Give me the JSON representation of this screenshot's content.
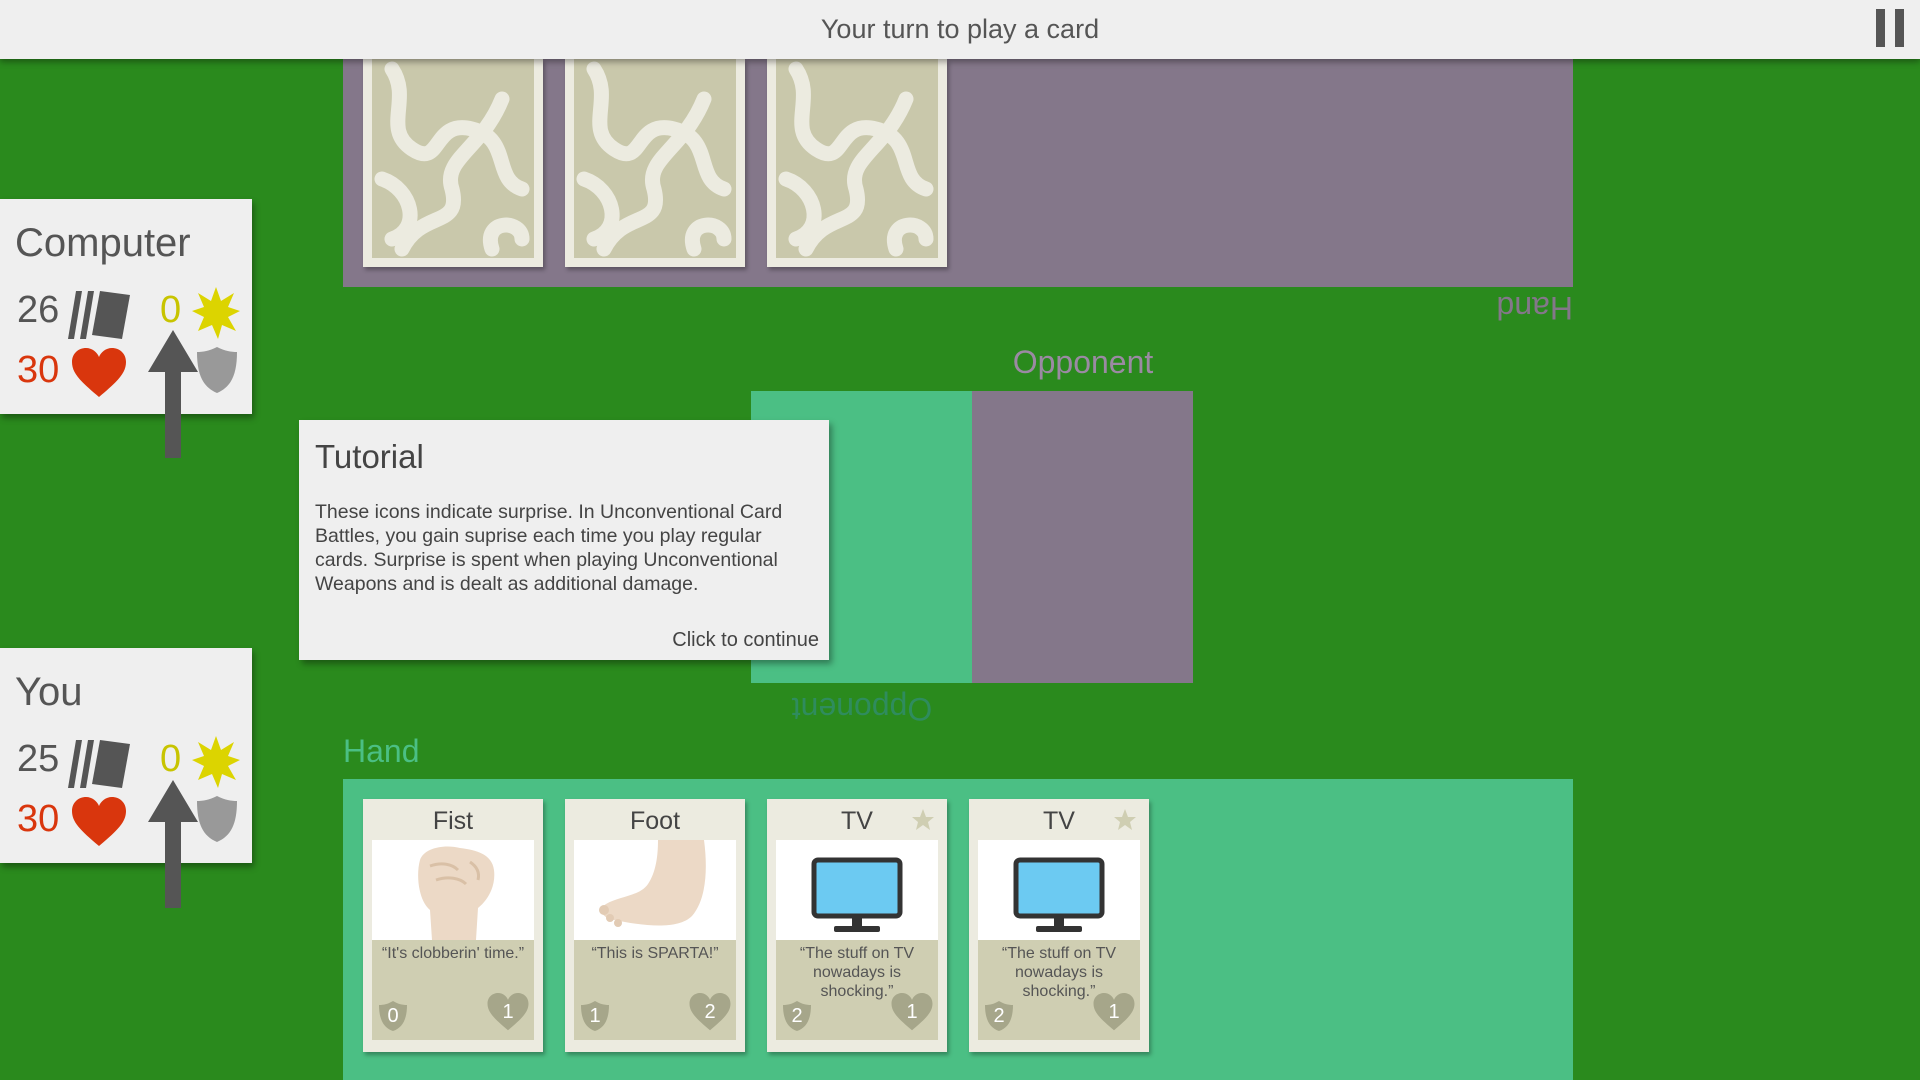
{
  "status": {
    "message": "Your turn to play a card",
    "pause_icon": "pause-icon"
  },
  "opponent_area": {
    "hand_label": "Hand",
    "hand_card_count": 3,
    "play_label": "Opponent"
  },
  "player_area": {
    "hand_label": "Hand",
    "play_label": "Opponent"
  },
  "computer": {
    "name": "Computer",
    "deck": "26",
    "health": "30",
    "surprise": "0"
  },
  "you": {
    "name": "You",
    "deck": "25",
    "health": "30",
    "surprise": "0"
  },
  "tutorial": {
    "title": "Tutorial",
    "body": "These icons indicate surprise. In Unconventional Card Battles, you gain suprise each time you play regular cards. Surprise is spent when playing Unconventional Weapons and is dealt as additional damage.",
    "continue": "Click to continue"
  },
  "hand": [
    {
      "title": "Fist",
      "quote": "“It's clobberin' time.”",
      "cost": "0",
      "damage": "1",
      "art": "fist-icon",
      "unconventional": false
    },
    {
      "title": "Foot",
      "quote": "“This is SPARTA!”",
      "cost": "1",
      "damage": "2",
      "art": "foot-icon",
      "unconventional": false
    },
    {
      "title": "TV",
      "quote": "“The stuff on TV nowadays is shocking.”",
      "cost": "2",
      "damage": "1",
      "art": "tv-icon",
      "unconventional": true
    },
    {
      "title": "TV",
      "quote": "“The stuff on TV nowadays is shocking.”",
      "cost": "2",
      "damage": "1",
      "art": "tv-icon",
      "unconventional": true
    }
  ],
  "colors": {
    "table": "#2a8a1d",
    "opponent_zone": "#84778a",
    "player_zone": "#4bbf84",
    "health": "#d9360d",
    "surprise": "#c8c400"
  }
}
